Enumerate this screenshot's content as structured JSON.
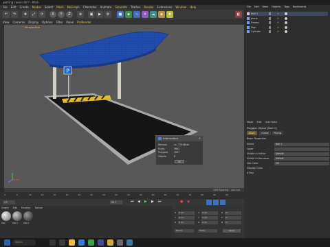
{
  "window": {
    "title": "parking cover.c4d * - Main"
  },
  "menu": [
    "File",
    "Edit",
    "Create",
    "Modes",
    "Select",
    "Mesh",
    "MoGraph",
    "Character",
    "Animate",
    "Simulate",
    "Tracker",
    "Render",
    "Extensions",
    "Window",
    "Help"
  ],
  "toolbar": {
    "x_label": "X",
    "y_label": "Y",
    "z_label": "Z"
  },
  "subtoolbar": [
    "View",
    "Cameras",
    "Display",
    "Options",
    "Filter",
    "Panel",
    "ProRender"
  ],
  "viewport": {
    "label": "Perspective",
    "status": "Grid Spacing : 100 cm",
    "sign_letter": "P"
  },
  "info_dialog": {
    "title": "Information",
    "rows": [
      {
        "k": "Memory",
        "v": "ca. 736 kByte"
      },
      {
        "k": "Points",
        "v": "3662"
      },
      {
        "k": "Polygons",
        "v": "3637"
      },
      {
        "k": "Objects",
        "v": "6"
      }
    ],
    "ok": "OK"
  },
  "timeline": {
    "ticks": [
      "0",
      "5",
      "10",
      "15",
      "20",
      "25",
      "30",
      "35",
      "40",
      "45",
      "50",
      "55",
      "60",
      "65",
      "70",
      "75",
      "80",
      "85",
      "90"
    ],
    "start": "0 F",
    "end": "90 F",
    "current": "0 F"
  },
  "object_manager": {
    "menu": [
      "File",
      "Edit",
      "View",
      "Objects",
      "Tags",
      "Bookmarks"
    ],
    "objects": [
      {
        "name": "Null 1"
      },
      {
        "name": "plane"
      },
      {
        "name": "Sweep"
      },
      {
        "name": "Sign"
      },
      {
        "name": "Cylinder"
      }
    ]
  },
  "attributes": {
    "menu": [
      "Mode",
      "Edit",
      "User Data"
    ],
    "object_label": "Polygon Object [Null 1]",
    "tabs": [
      "Basic",
      "Coord.",
      "Phong"
    ],
    "section": "Basic Properties",
    "rows": [
      {
        "label": "Name",
        "value": "Null 1"
      },
      {
        "label": "Layer",
        "value": ""
      },
      {
        "label": "Visible in Editor",
        "value": "Default"
      },
      {
        "label": "Visible in Renderer",
        "value": "Default"
      },
      {
        "label": "Use Color",
        "value": "Off"
      },
      {
        "label": "Display Color",
        "value": ""
      },
      {
        "label": "X-Ray",
        "value": ""
      }
    ]
  },
  "coords": {
    "rows": [
      [
        "X",
        "0 cm",
        "X",
        "0 cm",
        "H",
        "0 °"
      ],
      [
        "Y",
        "0 cm",
        "Y",
        "0 cm",
        "P",
        "0 °"
      ],
      [
        "Z",
        "0 cm",
        "Z",
        "0 cm",
        "B",
        "0 °"
      ]
    ],
    "world": "World",
    "scale": "Scale",
    "apply": "Apply"
  },
  "materials": {
    "menu": [
      "Create",
      "Edit",
      "Function",
      "Texture"
    ],
    "items": [
      "Mat",
      "Mat.1",
      "Mat.2"
    ]
  },
  "taskbar": {
    "search_placeholder": "Search"
  },
  "colors": {
    "accent": "#f2c34a",
    "canopy": "#1e49a8",
    "ground": "#161616",
    "active_tab": "#6a5a3a"
  }
}
